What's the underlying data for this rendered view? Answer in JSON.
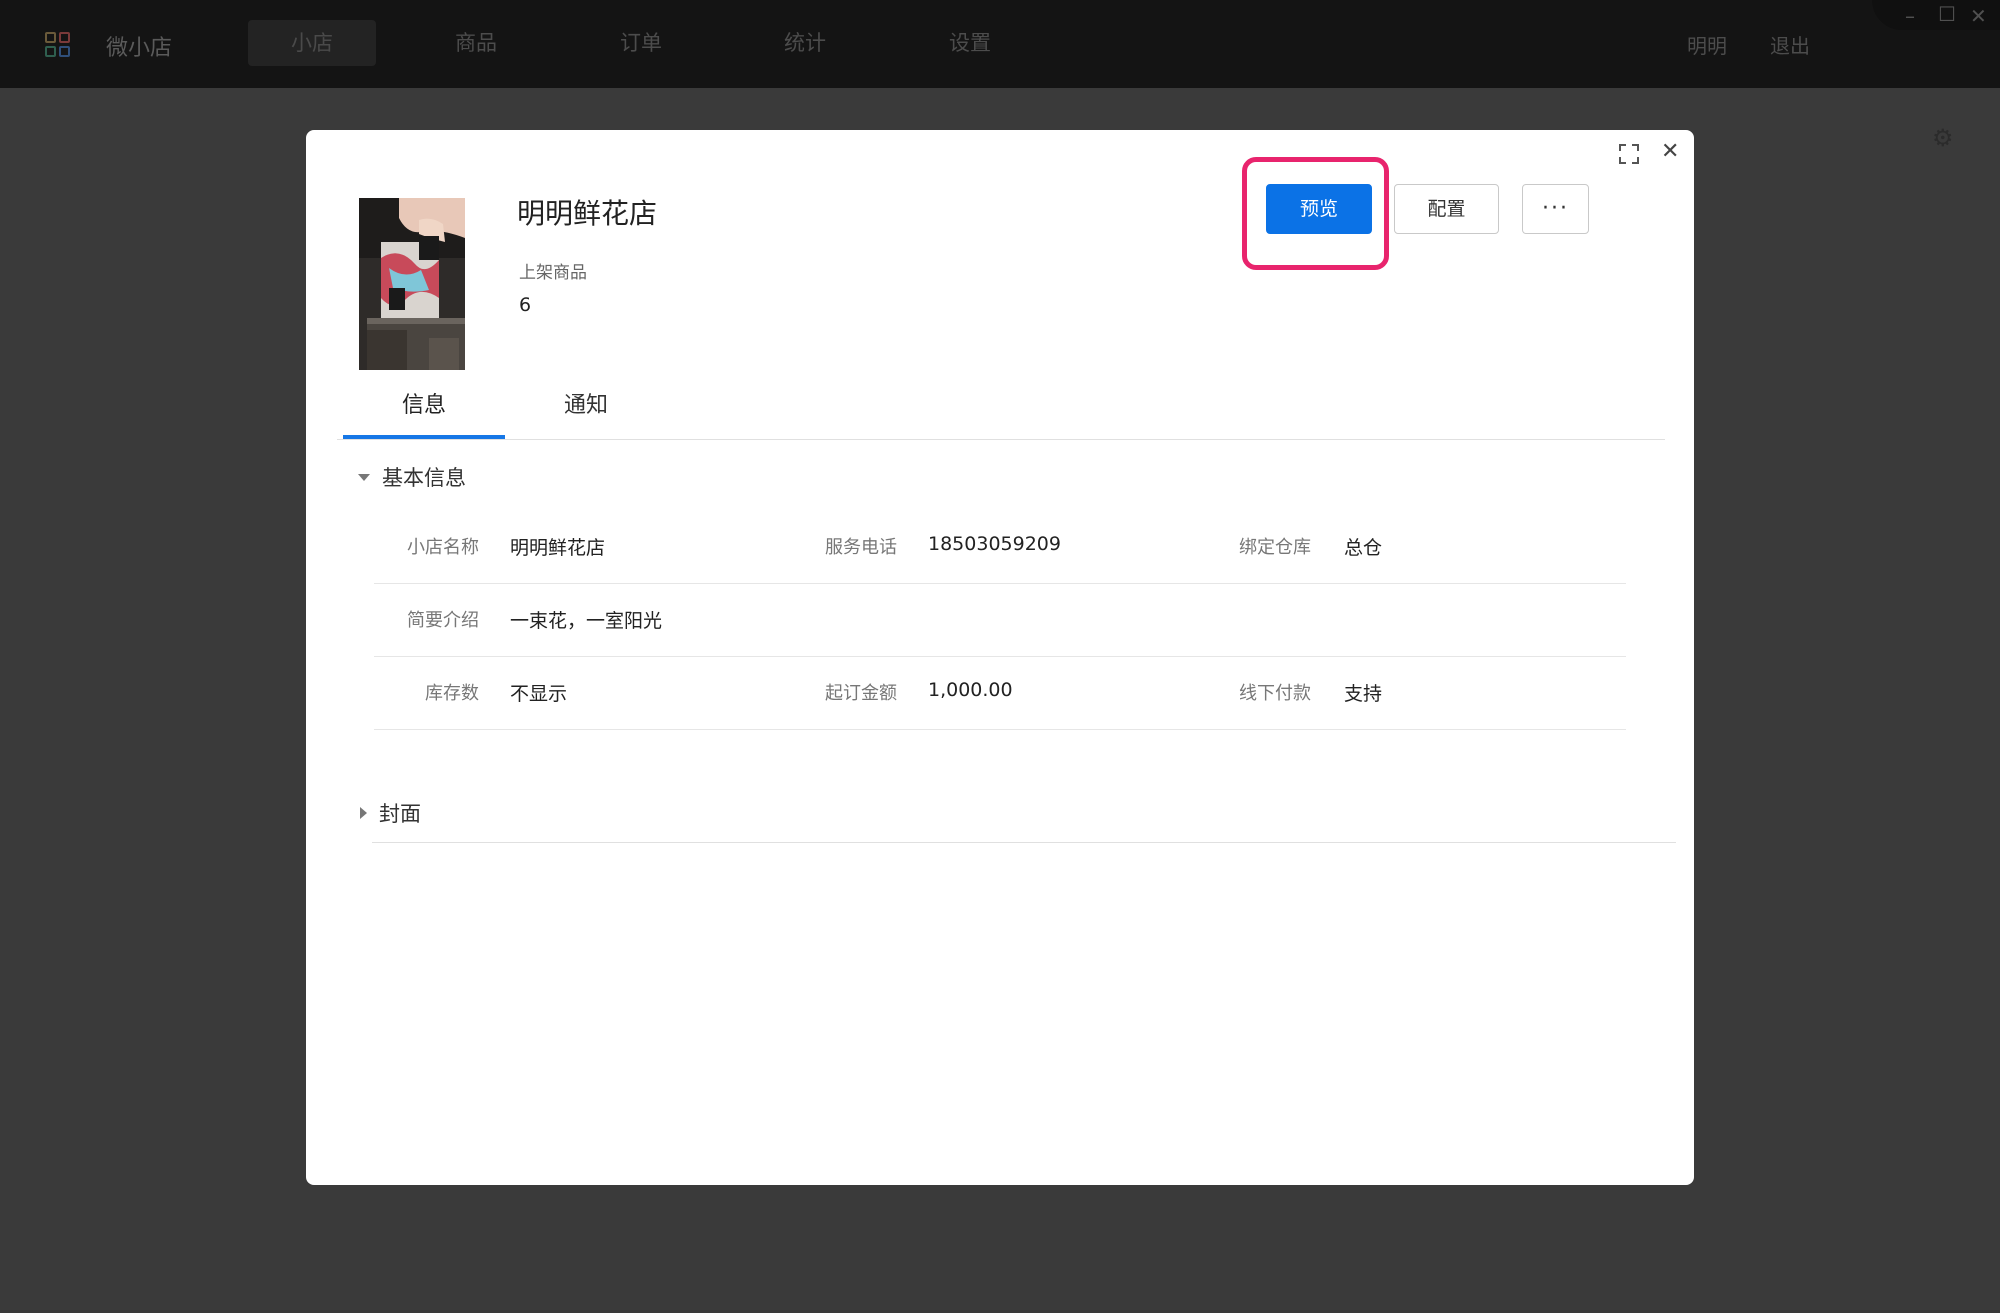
{
  "app": {
    "name": "微小店"
  },
  "nav": {
    "items": [
      {
        "label": "小店"
      },
      {
        "label": "商品"
      },
      {
        "label": "订单"
      },
      {
        "label": "统计"
      },
      {
        "label": "设置"
      }
    ]
  },
  "user": {
    "name": "明明",
    "logout": "退出"
  },
  "modal": {
    "store_name": "明明鲜花店",
    "stat_label": "上架商品",
    "stat_value": "6",
    "buttons": {
      "preview": "预览",
      "config": "配置",
      "more": "···"
    },
    "highlight_color": "#e8246d",
    "tabs": [
      {
        "label": "信息"
      },
      {
        "label": "通知"
      }
    ],
    "basic_info": {
      "title": "基本信息",
      "rows": [
        {
          "label": "小店名称",
          "value": "明明鲜花店",
          "label2": "服务电话",
          "value2": "18503059209",
          "label3": "绑定仓库",
          "value3": "总仓"
        },
        {
          "label": "简要介绍",
          "value": "一束花，一室阳光"
        },
        {
          "label": "库存数",
          "value": "不显示",
          "label2": "起订金额",
          "value2": "1,000.00",
          "label3": "线下付款",
          "value3": "支持"
        }
      ]
    },
    "cover": {
      "title": "封面"
    }
  },
  "colors": {
    "primary": "#0b72e6",
    "tab_active": "#1677e6"
  }
}
